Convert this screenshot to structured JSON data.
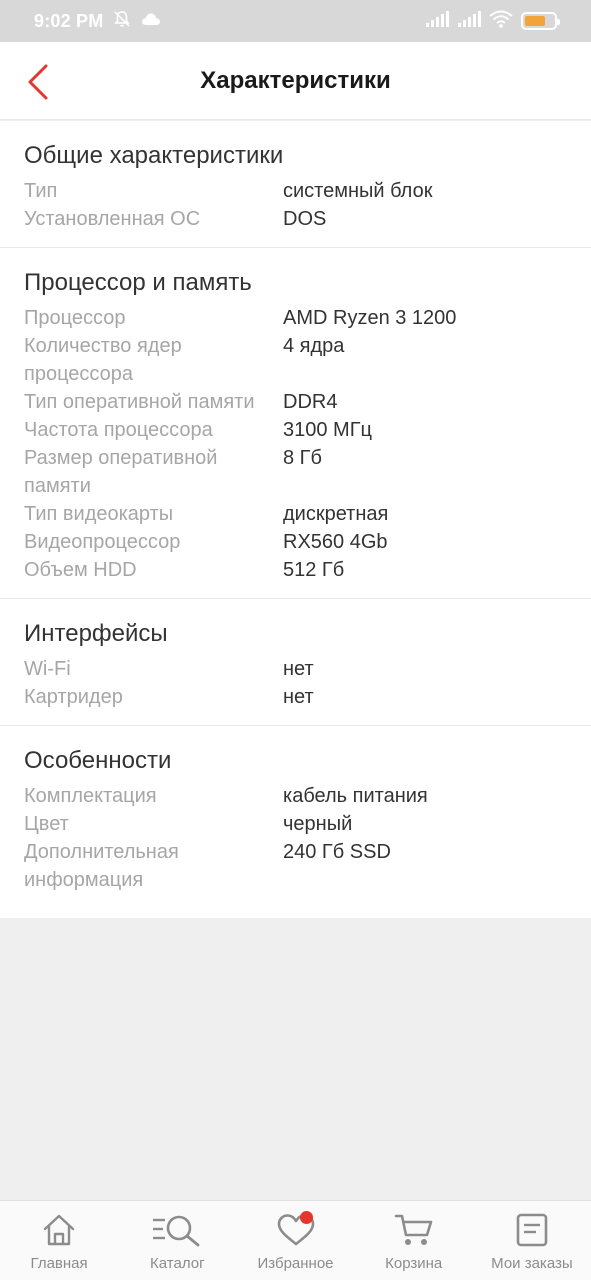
{
  "status_bar": {
    "time": "9:02 PM"
  },
  "header": {
    "title": "Характеристики",
    "accent_color": "#e5352d"
  },
  "sections": [
    {
      "title": "Общие характеристики",
      "rows": [
        {
          "label": "Тип",
          "value": "системный блок"
        },
        {
          "label": "Установленная ОС",
          "value": "DOS"
        }
      ]
    },
    {
      "title": "Процессор и память",
      "rows": [
        {
          "label": "Процессор",
          "value": "AMD Ryzen 3 1200"
        },
        {
          "label": "Количество ядер процессора",
          "value": "4 ядра"
        },
        {
          "label": "Тип оперативной памяти",
          "value": "DDR4"
        },
        {
          "label": "Частота процессора",
          "value": "3100 МГц"
        },
        {
          "label": "Размер оперативной памяти",
          "value": "8 Гб"
        },
        {
          "label": "Тип видеокарты",
          "value": "дискретная"
        },
        {
          "label": "Видеопроцессор",
          "value": "RX560 4Gb"
        },
        {
          "label": "Объем HDD",
          "value": "512 Гб"
        }
      ]
    },
    {
      "title": "Интерфейсы",
      "rows": [
        {
          "label": "Wi-Fi",
          "value": "нет"
        },
        {
          "label": "Картридер",
          "value": "нет"
        }
      ]
    },
    {
      "title": "Особенности",
      "rows": [
        {
          "label": "Комплектация",
          "value": "кабель питания"
        },
        {
          "label": "Цвет",
          "value": "черный"
        },
        {
          "label": "Дополнительная информация",
          "value": "240 Гб SSD"
        }
      ]
    }
  ],
  "bottom_nav": [
    {
      "label": "Главная",
      "icon": "home-icon"
    },
    {
      "label": "Каталог",
      "icon": "catalog-search-icon"
    },
    {
      "label": "Избранное",
      "icon": "heart-icon",
      "badge_dot": true
    },
    {
      "label": "Корзина",
      "icon": "cart-icon"
    },
    {
      "label": "Мои заказы",
      "icon": "orders-icon"
    }
  ]
}
